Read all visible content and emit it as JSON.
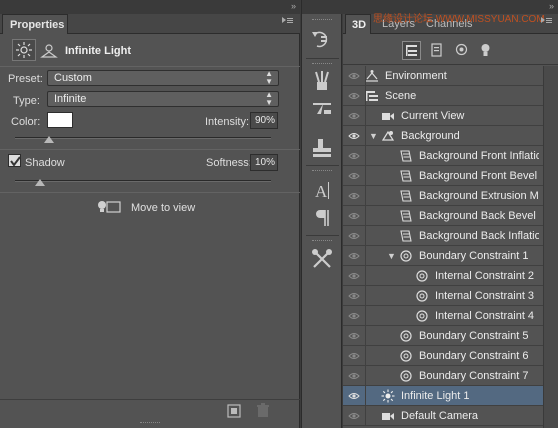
{
  "properties": {
    "tab_label": "Properties",
    "light_title": "Infinite Light",
    "preset_label": "Preset:",
    "preset_value": "Custom",
    "type_label": "Type:",
    "type_value": "Infinite",
    "color_label": "Color:",
    "color_value": "#ffffff",
    "intensity_label": "Intensity:",
    "intensity_value": "90%",
    "shadow_label": "Shadow",
    "shadow_checked": true,
    "softness_label": "Softness:",
    "softness_value": "10%",
    "move_to_view": "Move to view"
  },
  "tabs3d": {
    "tab_3d": "3D",
    "tab_layers": "Layers",
    "tab_channels": "Channels",
    "watermark": "思缘设计论坛 WWW.MISSYUAN.COM"
  },
  "scene_rows": [
    {
      "label": "Environment"
    },
    {
      "label": "Scene"
    },
    {
      "label": "Current View"
    },
    {
      "label": "Background"
    },
    {
      "label": "Background Front Inflatio..."
    },
    {
      "label": "Background Front Bevel M..."
    },
    {
      "label": "Background Extrusion Ma..."
    },
    {
      "label": "Background Back Bevel M..."
    },
    {
      "label": "Background Back Inflation..."
    },
    {
      "label": "Boundary Constraint 1"
    },
    {
      "label": "Internal Constraint 2"
    },
    {
      "label": "Internal Constraint 3"
    },
    {
      "label": "Internal Constraint 4"
    },
    {
      "label": "Boundary Constraint 5"
    },
    {
      "label": "Boundary Constraint 6"
    },
    {
      "label": "Boundary Constraint 7"
    },
    {
      "label": "Infinite Light 1"
    },
    {
      "label": "Default Camera"
    }
  ],
  "colors": {
    "panel": "#535353",
    "selection": "#536981"
  }
}
